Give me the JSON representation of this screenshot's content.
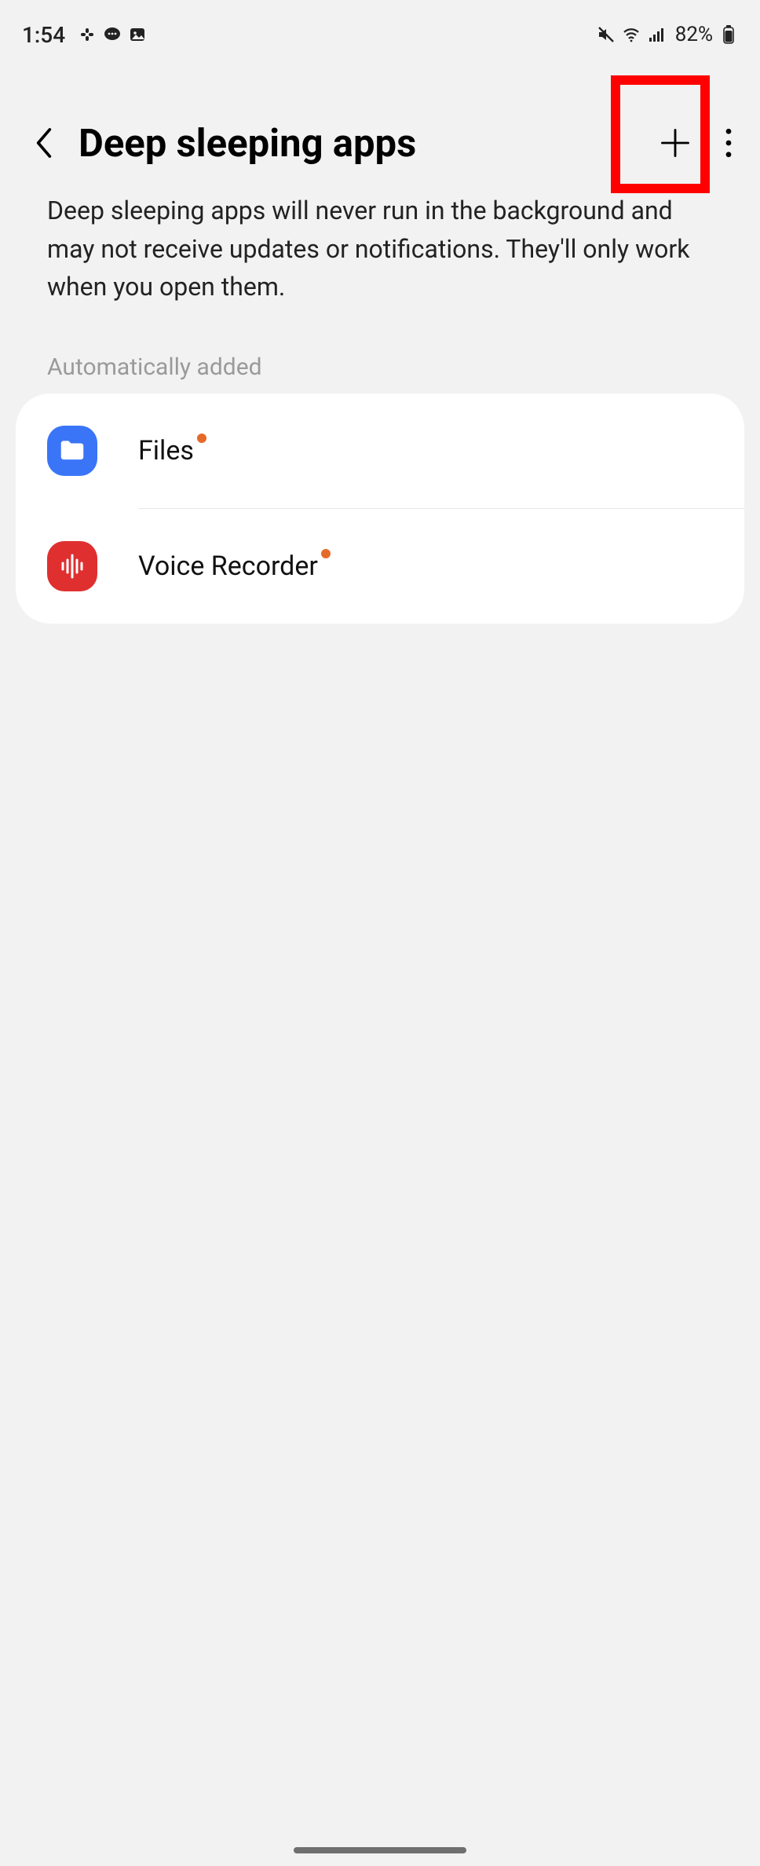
{
  "status": {
    "time": "1:54",
    "battery_pct": "82%"
  },
  "header": {
    "title": "Deep sleeping apps"
  },
  "description": "Deep sleeping apps will never run in the background and may not receive updates or notifications. They'll only work when you open them.",
  "section_label": "Automatically added",
  "apps": [
    {
      "label": "Files"
    },
    {
      "label": "Voice Recorder"
    }
  ]
}
